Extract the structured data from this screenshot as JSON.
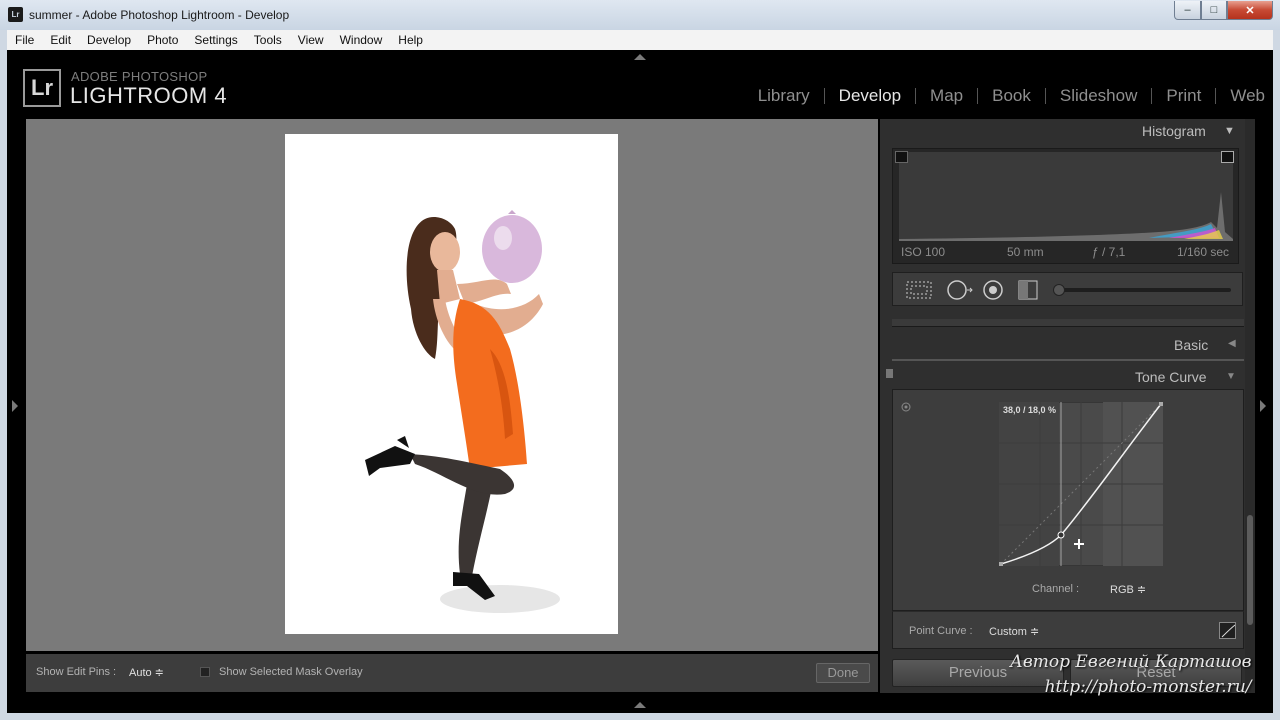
{
  "window": {
    "icon_text": "Lr",
    "title": "summer - Adobe Photoshop Lightroom - Develop",
    "min_glyph": "–",
    "max_glyph": "□",
    "close_glyph": "✕"
  },
  "menu": [
    "File",
    "Edit",
    "Develop",
    "Photo",
    "Settings",
    "Tools",
    "View",
    "Window",
    "Help"
  ],
  "brand": {
    "logo": "Lr",
    "line1": "ADOBE PHOTOSHOP",
    "line2": "LIGHTROOM 4"
  },
  "modules": [
    {
      "label": "Library"
    },
    {
      "label": "Develop",
      "active": true
    },
    {
      "label": "Map"
    },
    {
      "label": "Book"
    },
    {
      "label": "Slideshow"
    },
    {
      "label": "Print"
    },
    {
      "label": "Web"
    }
  ],
  "toolbar": {
    "pins_label": "Show Edit Pins :",
    "pins_value": "Auto ≑",
    "mask_label": "Show Selected Mask Overlay",
    "mask_checked": false,
    "done": "Done"
  },
  "histogram": {
    "header": "Histogram",
    "iso": "ISO 100",
    "focal": "50 mm",
    "aperture": "ƒ / 7,1",
    "shutter": "1/160 sec"
  },
  "tools": [
    "crop-overlay-icon",
    "spot-removal-icon",
    "red-eye-icon",
    "graduated-filter-icon",
    "adjustment-brush-icon"
  ],
  "panels": {
    "basic": "Basic",
    "tone_curve": "Tone Curve"
  },
  "tone_curve": {
    "readout": "38,0 / 18,0 %",
    "channel_label": "Channel :",
    "channel_value": "RGB ≑",
    "point_curve_label": "Point Curve :",
    "point_curve_value": "Custom ≑"
  },
  "buttons": {
    "previous": "Previous",
    "reset": "Reset"
  },
  "watermark": {
    "line1": "Автор Евгений Карташов",
    "line2": "http://photo-monster.ru/"
  },
  "colors": {
    "dress": "#f36c1e",
    "balloon": "#d9b8dc",
    "accent_white": "#e6e6e6"
  }
}
